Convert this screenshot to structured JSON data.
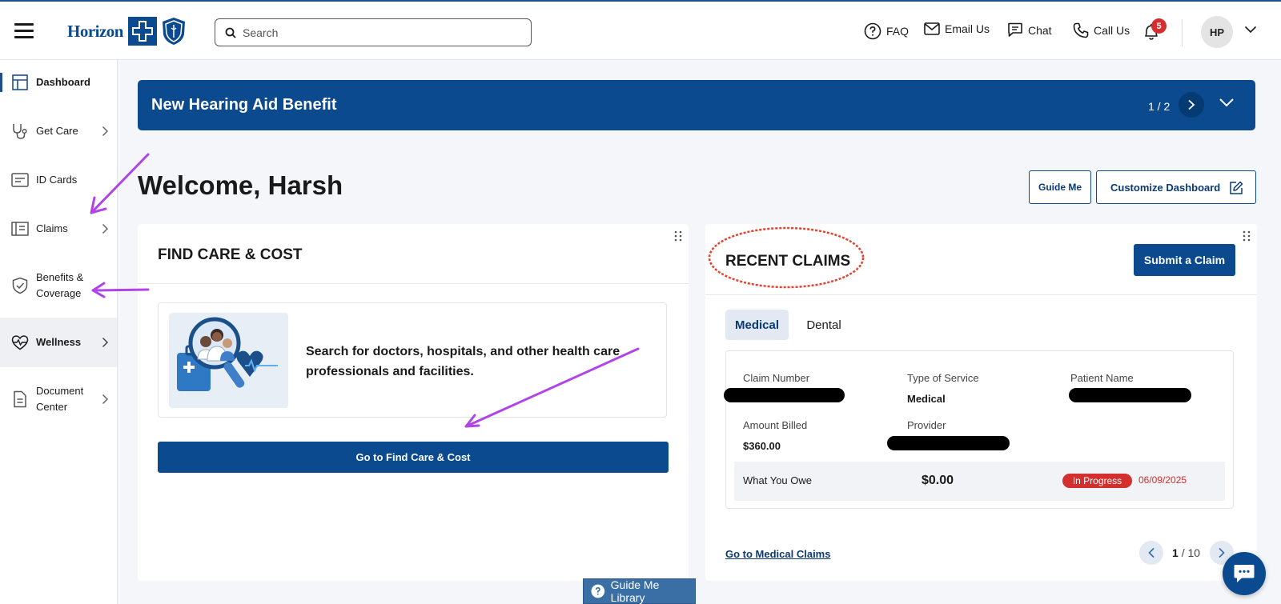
{
  "header": {
    "logo_text": "Horizon",
    "search_placeholder": "Search",
    "nav": {
      "faq": "FAQ",
      "email": "Email Us",
      "chat": "Chat",
      "call": "Call Us"
    },
    "notification_count": "5",
    "avatar_initials": "HP"
  },
  "sidebar": {
    "items": [
      {
        "label": "Dashboard",
        "icon": "dashboard-icon"
      },
      {
        "label": "Get Care",
        "icon": "stethoscope-icon"
      },
      {
        "label": "ID Cards",
        "icon": "id-card-icon"
      },
      {
        "label": "Claims",
        "icon": "claims-icon"
      },
      {
        "label": "Benefits &",
        "label2": "Coverage",
        "icon": "shield-check-icon"
      },
      {
        "label": "Wellness",
        "icon": "heart-pulse-icon"
      },
      {
        "label": "Document",
        "label2": "Center",
        "icon": "document-icon"
      }
    ]
  },
  "banner": {
    "title": "New Hearing Aid Benefit",
    "count": "1 / 2"
  },
  "welcome": "Welcome, Harsh",
  "actions": {
    "guide_me": "Guide Me",
    "customize": "Customize Dashboard"
  },
  "find_care": {
    "title": "FIND CARE & COST",
    "description": "Search for doctors, hospitals, and other health care professionals and facilities.",
    "button": "Go to Find Care & Cost"
  },
  "recent_claims": {
    "title": "RECENT CLAIMS",
    "submit_button": "Submit a Claim",
    "tabs": [
      "Medical",
      "Dental"
    ],
    "labels": {
      "claim_number": "Claim Number",
      "type_of_service": "Type of Service",
      "patient_name": "Patient Name",
      "amount_billed": "Amount Billed",
      "provider": "Provider",
      "what_you_owe": "What You Owe"
    },
    "values": {
      "type_of_service": "Medical",
      "amount_billed": "$360.00",
      "what_you_owe": "$0.00",
      "status": "In Progress",
      "date": "06/09/2025"
    },
    "link": "Go to Medical Claims",
    "page_current": "1",
    "page_total": "/ 10"
  },
  "footer": {
    "guide_library": "Guide Me Library"
  },
  "colors": {
    "brand": "#0b4a8e",
    "status_red": "#d32f2f",
    "annotation_purple": "#b044e8",
    "annotation_red": "#e8412c"
  }
}
